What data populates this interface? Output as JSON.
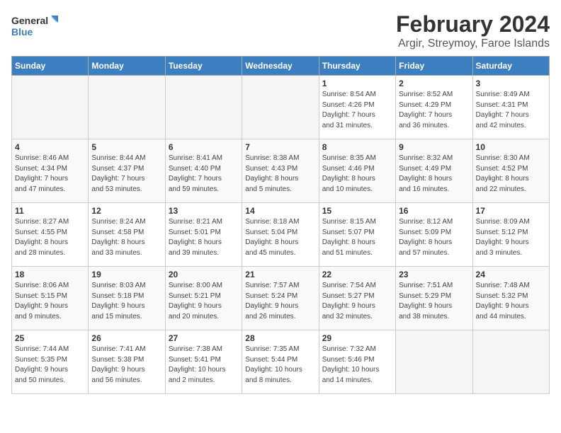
{
  "header": {
    "logo_line1": "General",
    "logo_line2": "Blue",
    "month": "February 2024",
    "location": "Argir, Streymoy, Faroe Islands"
  },
  "weekdays": [
    "Sunday",
    "Monday",
    "Tuesday",
    "Wednesday",
    "Thursday",
    "Friday",
    "Saturday"
  ],
  "weeks": [
    [
      {
        "day": "",
        "info": ""
      },
      {
        "day": "",
        "info": ""
      },
      {
        "day": "",
        "info": ""
      },
      {
        "day": "",
        "info": ""
      },
      {
        "day": "1",
        "info": "Sunrise: 8:54 AM\nSunset: 4:26 PM\nDaylight: 7 hours\nand 31 minutes."
      },
      {
        "day": "2",
        "info": "Sunrise: 8:52 AM\nSunset: 4:29 PM\nDaylight: 7 hours\nand 36 minutes."
      },
      {
        "day": "3",
        "info": "Sunrise: 8:49 AM\nSunset: 4:31 PM\nDaylight: 7 hours\nand 42 minutes."
      }
    ],
    [
      {
        "day": "4",
        "info": "Sunrise: 8:46 AM\nSunset: 4:34 PM\nDaylight: 7 hours\nand 47 minutes."
      },
      {
        "day": "5",
        "info": "Sunrise: 8:44 AM\nSunset: 4:37 PM\nDaylight: 7 hours\nand 53 minutes."
      },
      {
        "day": "6",
        "info": "Sunrise: 8:41 AM\nSunset: 4:40 PM\nDaylight: 7 hours\nand 59 minutes."
      },
      {
        "day": "7",
        "info": "Sunrise: 8:38 AM\nSunset: 4:43 PM\nDaylight: 8 hours\nand 5 minutes."
      },
      {
        "day": "8",
        "info": "Sunrise: 8:35 AM\nSunset: 4:46 PM\nDaylight: 8 hours\nand 10 minutes."
      },
      {
        "day": "9",
        "info": "Sunrise: 8:32 AM\nSunset: 4:49 PM\nDaylight: 8 hours\nand 16 minutes."
      },
      {
        "day": "10",
        "info": "Sunrise: 8:30 AM\nSunset: 4:52 PM\nDaylight: 8 hours\nand 22 minutes."
      }
    ],
    [
      {
        "day": "11",
        "info": "Sunrise: 8:27 AM\nSunset: 4:55 PM\nDaylight: 8 hours\nand 28 minutes."
      },
      {
        "day": "12",
        "info": "Sunrise: 8:24 AM\nSunset: 4:58 PM\nDaylight: 8 hours\nand 33 minutes."
      },
      {
        "day": "13",
        "info": "Sunrise: 8:21 AM\nSunset: 5:01 PM\nDaylight: 8 hours\nand 39 minutes."
      },
      {
        "day": "14",
        "info": "Sunrise: 8:18 AM\nSunset: 5:04 PM\nDaylight: 8 hours\nand 45 minutes."
      },
      {
        "day": "15",
        "info": "Sunrise: 8:15 AM\nSunset: 5:07 PM\nDaylight: 8 hours\nand 51 minutes."
      },
      {
        "day": "16",
        "info": "Sunrise: 8:12 AM\nSunset: 5:09 PM\nDaylight: 8 hours\nand 57 minutes."
      },
      {
        "day": "17",
        "info": "Sunrise: 8:09 AM\nSunset: 5:12 PM\nDaylight: 9 hours\nand 3 minutes."
      }
    ],
    [
      {
        "day": "18",
        "info": "Sunrise: 8:06 AM\nSunset: 5:15 PM\nDaylight: 9 hours\nand 9 minutes."
      },
      {
        "day": "19",
        "info": "Sunrise: 8:03 AM\nSunset: 5:18 PM\nDaylight: 9 hours\nand 15 minutes."
      },
      {
        "day": "20",
        "info": "Sunrise: 8:00 AM\nSunset: 5:21 PM\nDaylight: 9 hours\nand 20 minutes."
      },
      {
        "day": "21",
        "info": "Sunrise: 7:57 AM\nSunset: 5:24 PM\nDaylight: 9 hours\nand 26 minutes."
      },
      {
        "day": "22",
        "info": "Sunrise: 7:54 AM\nSunset: 5:27 PM\nDaylight: 9 hours\nand 32 minutes."
      },
      {
        "day": "23",
        "info": "Sunrise: 7:51 AM\nSunset: 5:29 PM\nDaylight: 9 hours\nand 38 minutes."
      },
      {
        "day": "24",
        "info": "Sunrise: 7:48 AM\nSunset: 5:32 PM\nDaylight: 9 hours\nand 44 minutes."
      }
    ],
    [
      {
        "day": "25",
        "info": "Sunrise: 7:44 AM\nSunset: 5:35 PM\nDaylight: 9 hours\nand 50 minutes."
      },
      {
        "day": "26",
        "info": "Sunrise: 7:41 AM\nSunset: 5:38 PM\nDaylight: 9 hours\nand 56 minutes."
      },
      {
        "day": "27",
        "info": "Sunrise: 7:38 AM\nSunset: 5:41 PM\nDaylight: 10 hours\nand 2 minutes."
      },
      {
        "day": "28",
        "info": "Sunrise: 7:35 AM\nSunset: 5:44 PM\nDaylight: 10 hours\nand 8 minutes."
      },
      {
        "day": "29",
        "info": "Sunrise: 7:32 AM\nSunset: 5:46 PM\nDaylight: 10 hours\nand 14 minutes."
      },
      {
        "day": "",
        "info": ""
      },
      {
        "day": "",
        "info": ""
      }
    ]
  ]
}
